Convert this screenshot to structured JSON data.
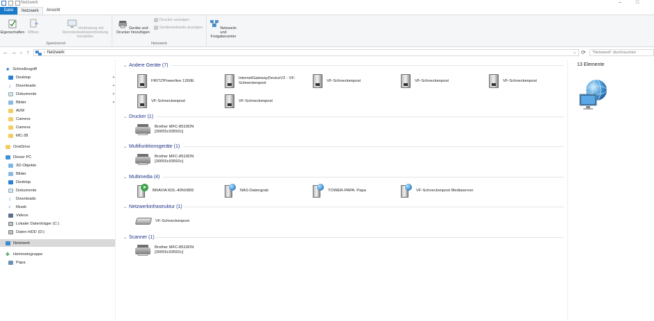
{
  "window": {
    "title": "Netzwerk"
  },
  "tabs": [
    {
      "label": "Datei"
    },
    {
      "label": "Netzwerk"
    },
    {
      "label": "Ansicht"
    }
  ],
  "ribbon": {
    "groups": [
      {
        "label": "Speicherort"
      },
      {
        "label": "Netzwerk"
      }
    ],
    "eigenschaften": "Eigenschaften",
    "oeffnen": "Öffnen",
    "remote": "Verbindung mit Remotedesktopverbindung herstellen",
    "geraete": "Geräte und Drucker hinzufügen",
    "drucker_anzeigen": "Drucker anzeigen",
    "webseite_anzeigen": "Gerätewebseite anzeigen",
    "freigabecenter": "Netzwerk- und Freigabecenter"
  },
  "address": {
    "crumb": "Netzwerk",
    "search_placeholder": "\"Netzwerk\" durchsuchen"
  },
  "nav": {
    "quick_access": "Schnellzugriff",
    "quick_items": [
      "Desktop",
      "Downloads",
      "Dokumente",
      "Bilder",
      "AVM",
      "Camera",
      "Camera",
      "MC-28"
    ],
    "onedrive": "OneDrive",
    "this_pc": "Dieser PC",
    "pc_items": [
      "3D-Objekte",
      "Bilder",
      "Desktop",
      "Dokumente",
      "Downloads",
      "Musik",
      "Videos",
      "Lokaler Datenträger (C:)",
      "Daten-HDD (D:)"
    ],
    "network": "Netzwerk",
    "homegroup": "Heimnetzgruppe",
    "homegroup_items": [
      "Papa"
    ]
  },
  "groups": [
    {
      "title": "Andere Geräte (7)",
      "items": [
        "FRITZ!Powerline 1260E",
        "InternetGatewayDeviceV2 - VF-Schneckenpost",
        "VF-Schneckenpost",
        "VF-Schneckenpost",
        "VF-Schneckenpost",
        "VF-Schneckenpost",
        "VF-Schneckenpost"
      ]
    },
    {
      "title": "Drucker (1)",
      "items": [
        "Brother MFC-8510DN [30055c93592c]"
      ]
    },
    {
      "title": "Multifunktionsgeräte (1)",
      "items": [
        "Brother MFC-8510DN [30055c93592c]"
      ]
    },
    {
      "title": "Multimedia (4)",
      "items": [
        "BRAVIA KDL-40NX805",
        "NAS-Datengrab",
        "TOWER-PAPA: Papa",
        "VF-Schneckenpost Mediaserver"
      ]
    },
    {
      "title": "Netzwerkinfrastruktur (1)",
      "items": [
        "VF-Schneckenpost"
      ]
    },
    {
      "title": "Scanner (1)",
      "items": [
        "Brother MFC-8510DN [30055c93592c]"
      ]
    }
  ],
  "details": {
    "count": "13 Elemente"
  },
  "colors": {
    "accent": "#1979ca",
    "group_header": "#1e3287",
    "selected_nav": "#d9d9d9"
  }
}
